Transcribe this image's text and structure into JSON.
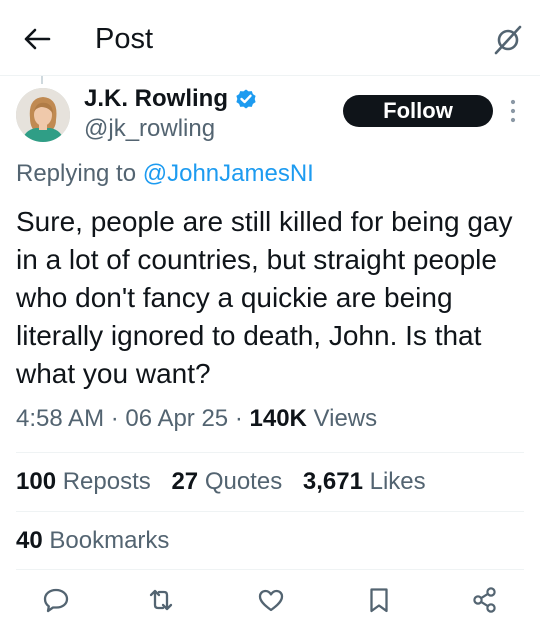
{
  "header": {
    "title": "Post",
    "back_icon": "arrow-left-icon",
    "grok_icon": "grok-icon"
  },
  "author": {
    "display_name": "J.K. Rowling",
    "handle": "@jk_rowling",
    "verified": true,
    "verified_color": "#1d9bf0",
    "avatar_icon": "avatar"
  },
  "follow_button": {
    "label": "Follow"
  },
  "reply_context": {
    "prefix": "Replying to",
    "handle": "@JohnJamesNI"
  },
  "tweet": {
    "text": "Sure, people are still killed for being gay in a lot of countries, but straight people who don't fancy a quickie are being literally ignored to death, John. Is that what you want?"
  },
  "meta": {
    "time": "4:58 AM",
    "separator": "·",
    "date": "06 Apr 25",
    "views_count": "140K",
    "views_label": "Views"
  },
  "stats": {
    "reposts_count": "100",
    "reposts_label": "Reposts",
    "quotes_count": "27",
    "quotes_label": "Quotes",
    "likes_count": "3,671",
    "likes_label": "Likes",
    "bookmarks_count": "40",
    "bookmarks_label": "Bookmarks"
  },
  "actions": [
    "reply-icon",
    "repost-icon",
    "like-icon",
    "bookmark-icon",
    "share-icon"
  ],
  "colors": {
    "text_primary": "#0f1419",
    "text_secondary": "#536471",
    "accent": "#1d9bf0",
    "divider": "#eff3f4"
  }
}
